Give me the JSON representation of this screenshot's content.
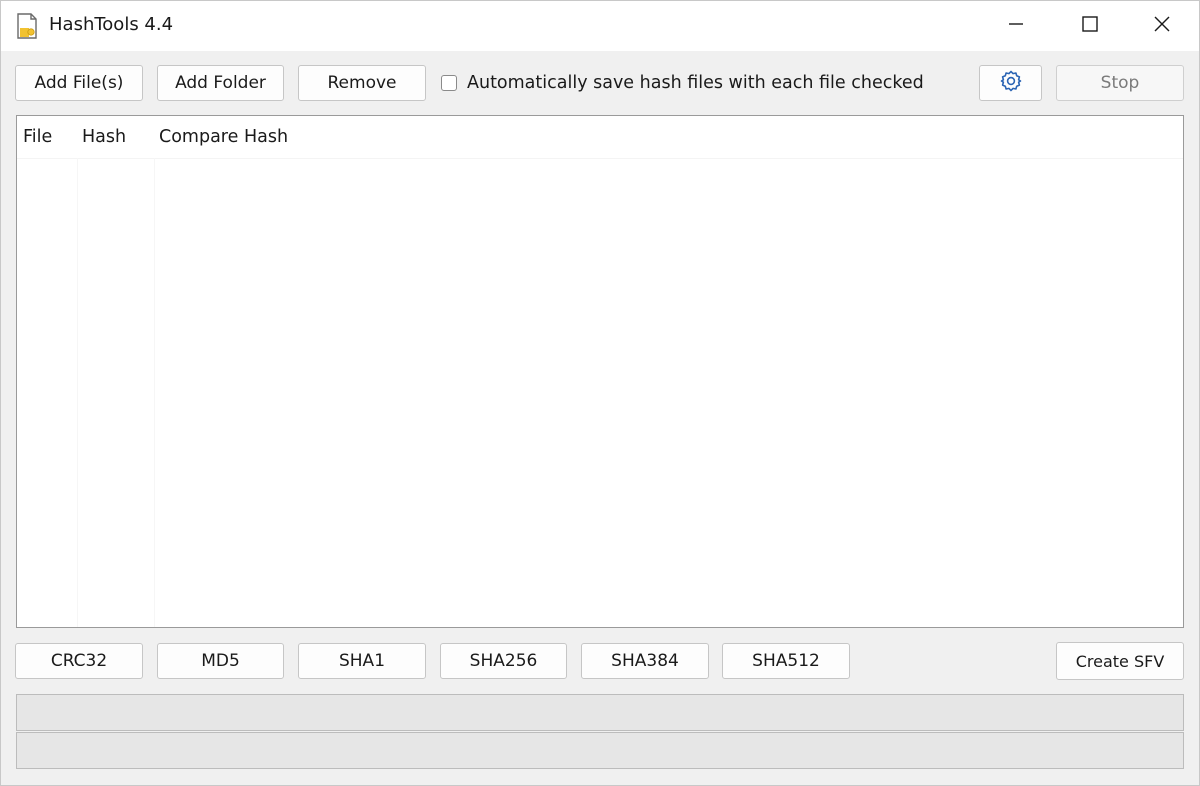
{
  "window": {
    "title": "HashTools 4.4"
  },
  "toolbar": {
    "add_files": "Add File(s)",
    "add_folder": "Add Folder",
    "remove": "Remove",
    "auto_save_label": "Automatically save hash files with each file checked",
    "auto_save_checked": false,
    "stop": "Stop"
  },
  "file_list": {
    "columns": [
      "File",
      "Hash",
      "Compare Hash"
    ],
    "rows": []
  },
  "hash_buttons": [
    "CRC32",
    "MD5",
    "SHA1",
    "SHA256",
    "SHA384",
    "SHA512"
  ],
  "create_sfv": "Create SFV",
  "icons": {
    "app": "hashtools-document-icon",
    "settings": "gear-icon",
    "minimize": "minimize-icon",
    "maximize": "maximize-icon",
    "close": "close-icon"
  },
  "colors": {
    "window_bg": "#f0f0f0",
    "titlebar_bg": "#ffffff",
    "gear_accent": "#2a64b4",
    "icon_yellow": "#f2c230"
  }
}
